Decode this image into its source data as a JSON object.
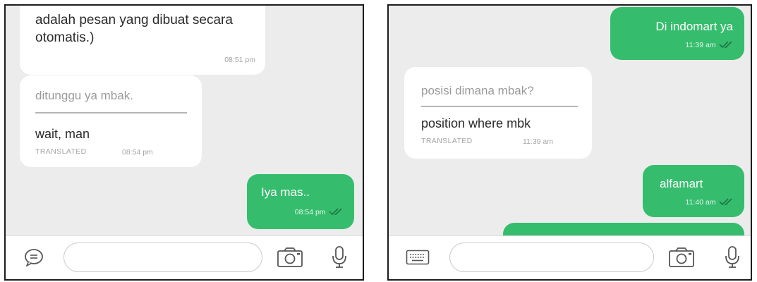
{
  "left_panel": {
    "messages": [
      {
        "text": "adalah pesan yang dibuat secara otomatis.)",
        "time": "08:51 pm"
      },
      {
        "original": "ditunggu ya mbak.",
        "translation": "wait, man",
        "translated_label": "TRANSLATED",
        "time": "08:54 pm"
      },
      {
        "text": "Iya mas..",
        "time": "08:54 pm",
        "status_icon": "double-check-icon"
      }
    ],
    "input_bar": {
      "left_icon": "message-icon",
      "placeholder": "",
      "icons": [
        "camera-icon",
        "microphone-icon"
      ]
    }
  },
  "right_panel": {
    "messages": [
      {
        "text": "Di indomart ya",
        "time": "11:39 am",
        "status_icon": "double-check-icon"
      },
      {
        "original": "posisi dimana mbak?",
        "translation": "position where mbk",
        "translated_label": "TRANSLATED",
        "time": "11:39 am"
      },
      {
        "text": "alfamart",
        "time": "11:40 am",
        "status_icon": "double-check-icon"
      }
    ],
    "input_bar": {
      "left_icon": "keyboard-icon",
      "placeholder": "",
      "icons": [
        "camera-icon",
        "microphone-icon"
      ]
    }
  },
  "colors": {
    "outgoing_bubble": "#35bd6d",
    "incoming_bubble": "#ffffff",
    "chat_background": "#ececec"
  }
}
